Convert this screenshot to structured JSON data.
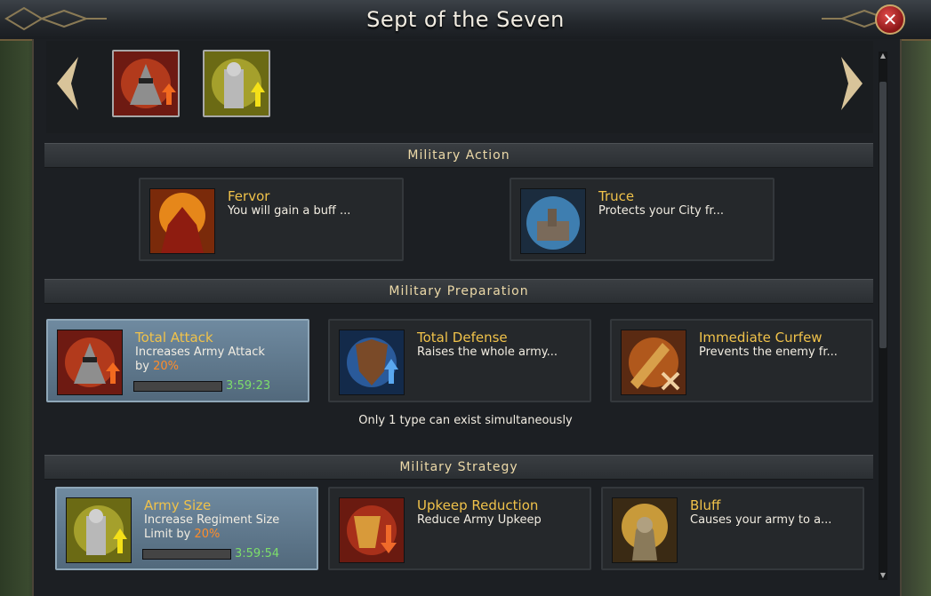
{
  "window": {
    "title": "Sept of the Seven",
    "close_icon": "close-icon"
  },
  "carousel": {
    "prev_icon": "chevron-left-icon",
    "next_icon": "chevron-right-icon",
    "thumbnails": [
      {
        "icon": "helmet-attack-up-icon"
      },
      {
        "icon": "knight-army-up-icon"
      }
    ]
  },
  "sections": [
    {
      "title": "Military Action",
      "cards": [
        {
          "name": "Fervor",
          "desc": "You will gain a buff ...",
          "icon": "fervor-warrior-icon"
        },
        {
          "name": "Truce",
          "desc": "Protects your City fr...",
          "icon": "city-shield-icon"
        }
      ]
    },
    {
      "title": "Military Preparation",
      "cards": [
        {
          "name": "Total Attack",
          "desc_line1": "Increases Army Attack",
          "desc_line2_prefix": "by ",
          "desc_pct": "20%",
          "timer": "3:59:23",
          "active": true,
          "icon": "helmet-attack-up-icon"
        },
        {
          "name": "Total Defense",
          "desc": "Raises the whole army...",
          "icon": "shield-defense-up-icon"
        },
        {
          "name": "Immediate Curfew",
          "desc": "Prevents the enemy fr...",
          "icon": "scroll-curfew-icon"
        }
      ],
      "note": "Only 1 type can exist simultaneously"
    },
    {
      "title": "Military Strategy",
      "cards": [
        {
          "name": "Army Size",
          "desc_line1": "Increase Regiment Size",
          "desc_line2_prefix": "Limit by ",
          "desc_pct": "20%",
          "timer": "3:59:54",
          "active": true,
          "icon": "knight-army-up-icon"
        },
        {
          "name": "Upkeep Reduction",
          "desc": "Reduce Army Upkeep",
          "icon": "grain-down-icon"
        },
        {
          "name": "Bluff",
          "desc": "Causes your army to a...",
          "icon": "golden-knight-icon"
        }
      ]
    }
  ],
  "colors": {
    "accent_gold": "#f0c24a",
    "timer_green": "#7dde6a",
    "percent_orange": "#ff8c2a",
    "active_card": "#6f8aa0"
  }
}
